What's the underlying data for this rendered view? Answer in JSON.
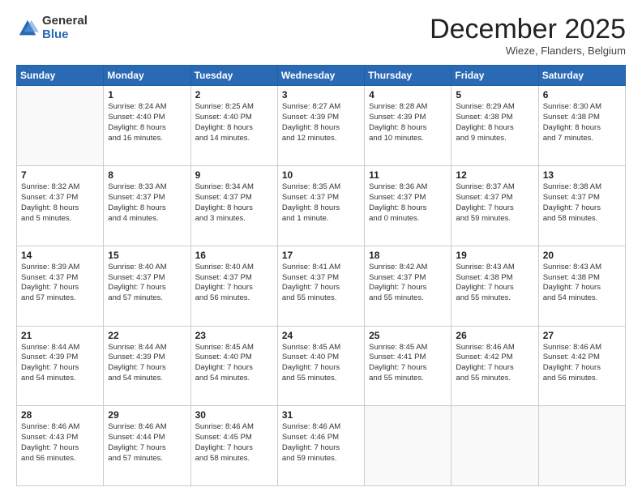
{
  "logo": {
    "general": "General",
    "blue": "Blue"
  },
  "header": {
    "month": "December 2025",
    "location": "Wieze, Flanders, Belgium"
  },
  "days": [
    "Sunday",
    "Monday",
    "Tuesday",
    "Wednesday",
    "Thursday",
    "Friday",
    "Saturday"
  ],
  "weeks": [
    [
      {
        "day": "",
        "info": ""
      },
      {
        "day": "1",
        "info": "Sunrise: 8:24 AM\nSunset: 4:40 PM\nDaylight: 8 hours\nand 16 minutes."
      },
      {
        "day": "2",
        "info": "Sunrise: 8:25 AM\nSunset: 4:40 PM\nDaylight: 8 hours\nand 14 minutes."
      },
      {
        "day": "3",
        "info": "Sunrise: 8:27 AM\nSunset: 4:39 PM\nDaylight: 8 hours\nand 12 minutes."
      },
      {
        "day": "4",
        "info": "Sunrise: 8:28 AM\nSunset: 4:39 PM\nDaylight: 8 hours\nand 10 minutes."
      },
      {
        "day": "5",
        "info": "Sunrise: 8:29 AM\nSunset: 4:38 PM\nDaylight: 8 hours\nand 9 minutes."
      },
      {
        "day": "6",
        "info": "Sunrise: 8:30 AM\nSunset: 4:38 PM\nDaylight: 8 hours\nand 7 minutes."
      }
    ],
    [
      {
        "day": "7",
        "info": "Sunrise: 8:32 AM\nSunset: 4:37 PM\nDaylight: 8 hours\nand 5 minutes."
      },
      {
        "day": "8",
        "info": "Sunrise: 8:33 AM\nSunset: 4:37 PM\nDaylight: 8 hours\nand 4 minutes."
      },
      {
        "day": "9",
        "info": "Sunrise: 8:34 AM\nSunset: 4:37 PM\nDaylight: 8 hours\nand 3 minutes."
      },
      {
        "day": "10",
        "info": "Sunrise: 8:35 AM\nSunset: 4:37 PM\nDaylight: 8 hours\nand 1 minute."
      },
      {
        "day": "11",
        "info": "Sunrise: 8:36 AM\nSunset: 4:37 PM\nDaylight: 8 hours\nand 0 minutes."
      },
      {
        "day": "12",
        "info": "Sunrise: 8:37 AM\nSunset: 4:37 PM\nDaylight: 7 hours\nand 59 minutes."
      },
      {
        "day": "13",
        "info": "Sunrise: 8:38 AM\nSunset: 4:37 PM\nDaylight: 7 hours\nand 58 minutes."
      }
    ],
    [
      {
        "day": "14",
        "info": "Sunrise: 8:39 AM\nSunset: 4:37 PM\nDaylight: 7 hours\nand 57 minutes."
      },
      {
        "day": "15",
        "info": "Sunrise: 8:40 AM\nSunset: 4:37 PM\nDaylight: 7 hours\nand 57 minutes."
      },
      {
        "day": "16",
        "info": "Sunrise: 8:40 AM\nSunset: 4:37 PM\nDaylight: 7 hours\nand 56 minutes."
      },
      {
        "day": "17",
        "info": "Sunrise: 8:41 AM\nSunset: 4:37 PM\nDaylight: 7 hours\nand 55 minutes."
      },
      {
        "day": "18",
        "info": "Sunrise: 8:42 AM\nSunset: 4:37 PM\nDaylight: 7 hours\nand 55 minutes."
      },
      {
        "day": "19",
        "info": "Sunrise: 8:43 AM\nSunset: 4:38 PM\nDaylight: 7 hours\nand 55 minutes."
      },
      {
        "day": "20",
        "info": "Sunrise: 8:43 AM\nSunset: 4:38 PM\nDaylight: 7 hours\nand 54 minutes."
      }
    ],
    [
      {
        "day": "21",
        "info": "Sunrise: 8:44 AM\nSunset: 4:39 PM\nDaylight: 7 hours\nand 54 minutes."
      },
      {
        "day": "22",
        "info": "Sunrise: 8:44 AM\nSunset: 4:39 PM\nDaylight: 7 hours\nand 54 minutes."
      },
      {
        "day": "23",
        "info": "Sunrise: 8:45 AM\nSunset: 4:40 PM\nDaylight: 7 hours\nand 54 minutes."
      },
      {
        "day": "24",
        "info": "Sunrise: 8:45 AM\nSunset: 4:40 PM\nDaylight: 7 hours\nand 55 minutes."
      },
      {
        "day": "25",
        "info": "Sunrise: 8:45 AM\nSunset: 4:41 PM\nDaylight: 7 hours\nand 55 minutes."
      },
      {
        "day": "26",
        "info": "Sunrise: 8:46 AM\nSunset: 4:42 PM\nDaylight: 7 hours\nand 55 minutes."
      },
      {
        "day": "27",
        "info": "Sunrise: 8:46 AM\nSunset: 4:42 PM\nDaylight: 7 hours\nand 56 minutes."
      }
    ],
    [
      {
        "day": "28",
        "info": "Sunrise: 8:46 AM\nSunset: 4:43 PM\nDaylight: 7 hours\nand 56 minutes."
      },
      {
        "day": "29",
        "info": "Sunrise: 8:46 AM\nSunset: 4:44 PM\nDaylight: 7 hours\nand 57 minutes."
      },
      {
        "day": "30",
        "info": "Sunrise: 8:46 AM\nSunset: 4:45 PM\nDaylight: 7 hours\nand 58 minutes."
      },
      {
        "day": "31",
        "info": "Sunrise: 8:46 AM\nSunset: 4:46 PM\nDaylight: 7 hours\nand 59 minutes."
      },
      {
        "day": "",
        "info": ""
      },
      {
        "day": "",
        "info": ""
      },
      {
        "day": "",
        "info": ""
      }
    ]
  ]
}
